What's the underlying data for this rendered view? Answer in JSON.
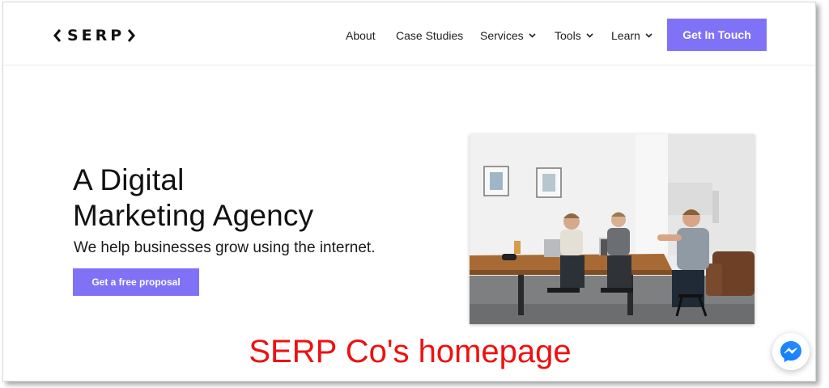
{
  "brand": {
    "name": "SERP",
    "accent": "#7f72f7"
  },
  "nav": {
    "about": "About",
    "case_studies": "Case Studies",
    "services": "Services",
    "tools": "Tools",
    "learn": "Learn",
    "cta": "Get In Touch"
  },
  "hero": {
    "title_line1": "A Digital",
    "title_line2": "Marketing Agency",
    "subtitle": "We help businesses grow using the internet.",
    "button": "Get a free proposal"
  },
  "caption": {
    "text": "SERP Co's homepage",
    "color": "#ee1111"
  },
  "icons": {
    "logo_left": "chevron-left-icon",
    "logo_right": "chevron-right-icon",
    "dropdown": "chevron-down-icon",
    "chat": "messenger-icon"
  }
}
